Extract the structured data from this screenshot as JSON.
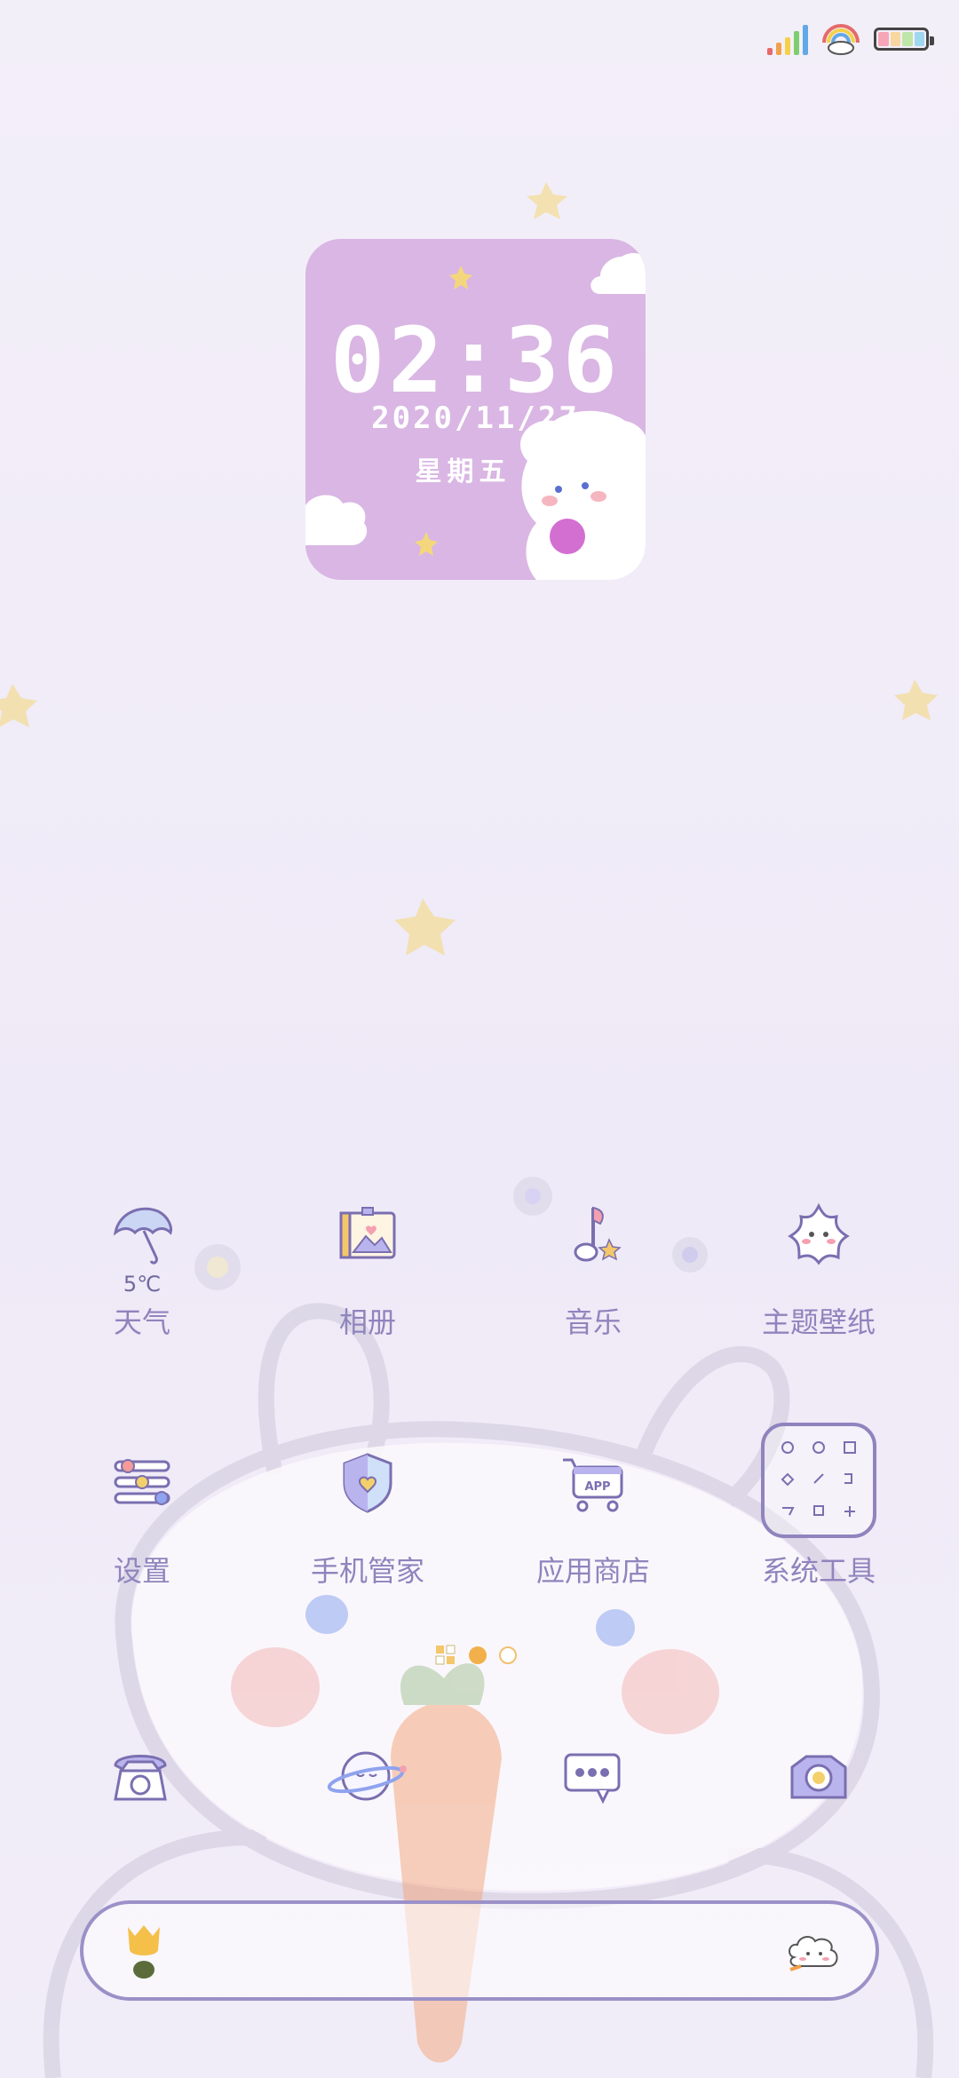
{
  "clock": {
    "time": "02:36",
    "date": "2020/11/27",
    "weekday": "星期五"
  },
  "weather": {
    "temp": "5℃"
  },
  "apps_row1": [
    {
      "label": "天气",
      "icon": "umbrella-icon"
    },
    {
      "label": "相册",
      "icon": "photo-album-icon"
    },
    {
      "label": "音乐",
      "icon": "music-note-icon"
    },
    {
      "label": "主题壁纸",
      "icon": "star-theme-icon"
    }
  ],
  "apps_row2": [
    {
      "label": "设置",
      "icon": "sliders-icon"
    },
    {
      "label": "手机管家",
      "icon": "shield-icon"
    },
    {
      "label": "应用商店",
      "icon": "app-store-cart-icon"
    },
    {
      "label": "系统工具",
      "icon": "tools-folder-icon"
    }
  ],
  "app_store_badge": "APP",
  "dock": [
    "phone-icon",
    "browser-planet-icon",
    "messages-icon",
    "camera-icon"
  ],
  "colors": {
    "accent": "#7a6fb0",
    "widget": "#d9b6e3",
    "label": "#8f84bd"
  }
}
